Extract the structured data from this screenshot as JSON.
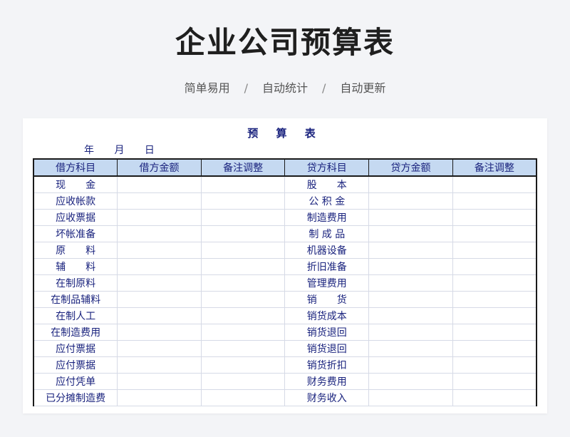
{
  "header": {
    "title": "企业公司预算表",
    "tags": [
      "简单易用",
      "自动统计",
      "自动更新"
    ],
    "separator": "/"
  },
  "sheet": {
    "title": "预 算 表",
    "date_labels": [
      "年",
      "月",
      "日"
    ],
    "columns": [
      "借方科目",
      "借方金额",
      "备注调整",
      "贷方科目",
      "贷方金额",
      "备注调整"
    ],
    "rows": [
      {
        "debit": "现　　金",
        "credit": "股　　本"
      },
      {
        "debit": "应收帐款",
        "credit": "公 积 金"
      },
      {
        "debit": "应收票据",
        "credit": "制造费用"
      },
      {
        "debit": "坏帐准备",
        "credit": "制 成 品"
      },
      {
        "debit": "原　　料",
        "credit": "机器设备"
      },
      {
        "debit": "辅　　料",
        "credit": "折旧准备"
      },
      {
        "debit": "在制原料",
        "credit": "管理费用"
      },
      {
        "debit": "在制品辅料",
        "credit": "销　　货"
      },
      {
        "debit": "在制人工",
        "credit": "销货成本"
      },
      {
        "debit": "在制造费用",
        "credit": "销货退回"
      },
      {
        "debit": "应付票据",
        "credit": "销货退回"
      },
      {
        "debit": "应付票据",
        "credit": "销货折扣"
      },
      {
        "debit": "应付凭单",
        "credit": "财务费用"
      },
      {
        "debit": "已分摊制造费",
        "credit": "财务收入"
      }
    ]
  },
  "colors": {
    "header_fill": "#c5d9f1",
    "text_navy": "#1a237e",
    "page_bg": "#f3f4f7"
  }
}
